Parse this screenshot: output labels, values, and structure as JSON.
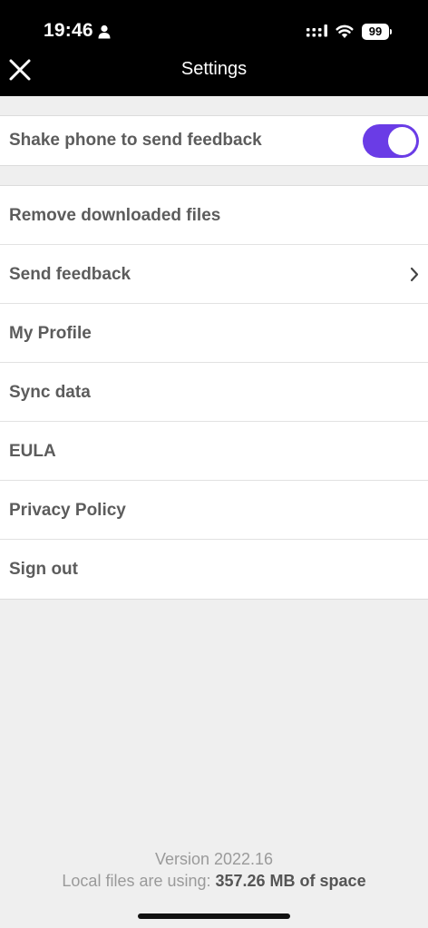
{
  "status_bar": {
    "time": "19:46",
    "battery": "99",
    "icons": [
      "person-icon",
      "signal-icon",
      "wifi-icon",
      "battery-icon"
    ]
  },
  "nav": {
    "title": "Settings",
    "close_icon": "close-icon"
  },
  "toggle_section": {
    "label": "Shake phone to send feedback",
    "enabled": true,
    "accent_color": "#6a3ce6"
  },
  "menu": {
    "items": [
      {
        "label": "Remove downloaded files"
      },
      {
        "label": "Send feedback",
        "chevron": true
      },
      {
        "label": "My Profile"
      },
      {
        "label": "Sync data"
      },
      {
        "label": "EULA"
      },
      {
        "label": "Privacy Policy"
      },
      {
        "label": "Sign out"
      }
    ]
  },
  "footer": {
    "version": "Version 2022.16",
    "storage_prefix": "Local files are using: ",
    "storage_value": "357.26 MB of space"
  }
}
